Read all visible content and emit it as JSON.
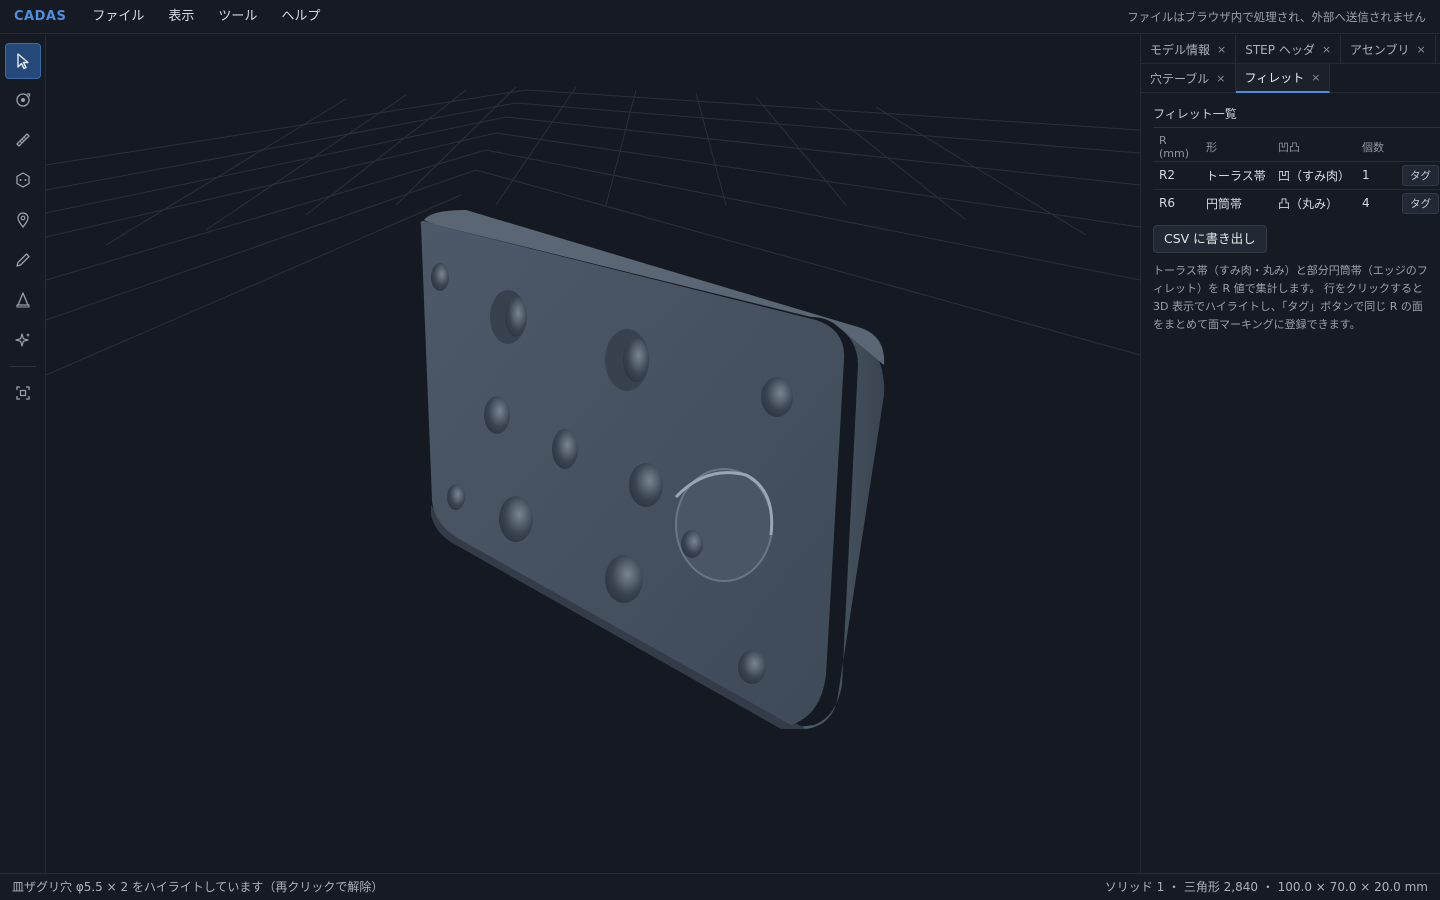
{
  "app": {
    "brand": "CADAS"
  },
  "menu": {
    "items": [
      "ファイル",
      "表示",
      "ツール",
      "ヘルプ"
    ]
  },
  "header": {
    "privacy_note": "ファイルはブラウザ内で処理され、外部へ送信されません"
  },
  "toolbar": {
    "tools": [
      {
        "name": "select-tool",
        "icon": "cursor-icon",
        "active": true
      },
      {
        "name": "orbit-tool",
        "icon": "orbit-icon",
        "active": false
      },
      {
        "name": "measure-tool",
        "icon": "ruler-icon",
        "active": false
      },
      {
        "name": "face-tool",
        "icon": "face-icon",
        "active": false
      },
      {
        "name": "marker-tool",
        "icon": "pin-icon",
        "active": false
      },
      {
        "name": "pen-tool",
        "icon": "pen-icon",
        "active": false
      },
      {
        "name": "cone-tool",
        "icon": "cone-icon",
        "active": false
      },
      {
        "name": "sparkle-tool",
        "icon": "sparkle-icon",
        "active": false
      },
      {
        "name": "fit-view-tool",
        "icon": "fit-view-icon",
        "active": false
      }
    ]
  },
  "panel": {
    "tabs_row1": [
      {
        "label": "モデル情報",
        "close": "×"
      },
      {
        "label": "STEP ヘッダ",
        "close": "×"
      },
      {
        "label": "アセンブリ",
        "close": "×"
      }
    ],
    "tabs_row2": [
      {
        "label": "穴テーブル",
        "close": "×"
      },
      {
        "label": "フィレット",
        "close": "×",
        "active": true
      }
    ],
    "section_title": "フィレット一覧",
    "table": {
      "headers": [
        "R (mm)",
        "形",
        "凹凸",
        "個数",
        ""
      ],
      "rows": [
        {
          "r": "R2",
          "shape": "トーラス帯",
          "convexity": "凹（すみ肉）",
          "count": "1",
          "tag": "タグ"
        },
        {
          "r": "R6",
          "shape": "円筒帯",
          "convexity": "凸（丸み）",
          "count": "4",
          "tag": "タグ"
        }
      ]
    },
    "csv_button": "CSV に書き出し",
    "help_text": "トーラス帯（すみ肉・丸み）と部分円筒帯（エッジのフィレット）を R 値で集計します。 行をクリックすると 3D 表示でハイライトし、「タグ」ボタンで同じ R の面をまとめて面マーキングに登録できます。"
  },
  "status": {
    "left": "皿ザグリ穴 φ5.5 × 2 をハイライトしています（再クリックで解除）",
    "right": "ソリッド 1 ・ 三角形 2,840 ・ 100.0 × 70.0 × 20.0 mm"
  },
  "colors": {
    "accent": "#4a8fe0",
    "model": "#4a5565",
    "background": "#151922"
  }
}
